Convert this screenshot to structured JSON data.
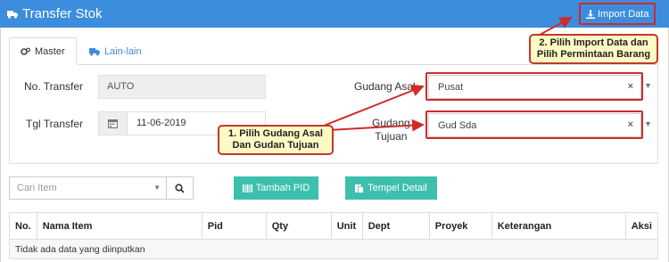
{
  "header": {
    "title": "Transfer Stok",
    "import_label": "Import Data"
  },
  "tabs": [
    {
      "label": "Master",
      "active": true
    },
    {
      "label": "Lain-lain",
      "active": false
    }
  ],
  "form": {
    "no_transfer_label": "No. Transfer",
    "no_transfer_value": "AUTO",
    "tgl_transfer_label": "Tgl Transfer",
    "tgl_transfer_value": "11-06-2019",
    "gudang_asal_label": "Gudang Asal",
    "gudang_asal_value": "Pusat",
    "gudang_tujuan_label_1": "Gudang",
    "gudang_tujuan_label_2": "Tujuan",
    "gudang_tujuan_value": "Gud Sda"
  },
  "annotations": {
    "callout_1_line1": "1. Pilih Gudang Asal",
    "callout_1_line2": "Dan Gudan Tujuan",
    "callout_2_line1": "2. Pilih Import Data dan",
    "callout_2_line2": "Pilih Permintaan Barang"
  },
  "toolbar": {
    "search_placeholder": "Cari Item",
    "tambah_pid_label": "Tambah PID",
    "tempel_detail_label": "Tempel Detail"
  },
  "table": {
    "columns": [
      "No.",
      "Nama Item",
      "Pid",
      "Qty",
      "Unit",
      "Dept",
      "Proyek",
      "Keterangan",
      "Aksi"
    ],
    "empty_message": "Tidak ada data yang diinputkan"
  },
  "colors": {
    "primary": "#3c8dde",
    "teal": "#3dbfae",
    "annotation_red": "#d12a2a",
    "callout_bg": "#fff9c4"
  },
  "icons": {
    "truck": "truck-icon",
    "download": "download-icon",
    "cogs": "cogs-icon",
    "calendar": "calendar-icon",
    "search": "search-icon",
    "barcode": "barcode-icon",
    "paste": "paste-icon"
  }
}
